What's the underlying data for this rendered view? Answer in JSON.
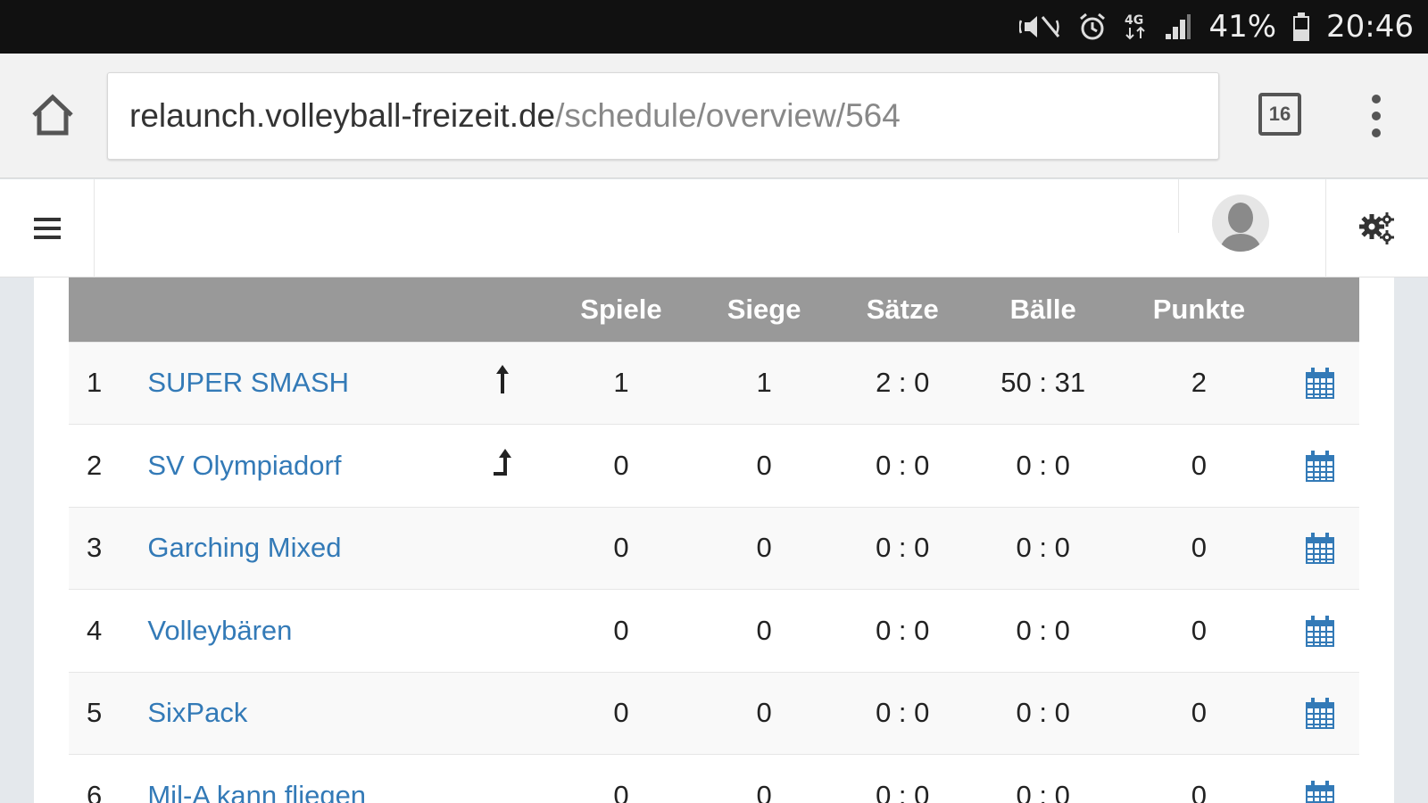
{
  "status_bar": {
    "battery_percent": "41%",
    "time": "20:46",
    "network": "4G"
  },
  "browser": {
    "url_host": "relaunch.volleyball-freizeit.de",
    "url_path": "/schedule/overview/564",
    "tab_count": "16"
  },
  "table": {
    "headers": {
      "spiele": "Spiele",
      "siege": "Siege",
      "saetze": "Sätze",
      "baelle": "Bälle",
      "punkte": "Punkte"
    },
    "rows": [
      {
        "rank": "1",
        "team": "SUPER SMASH",
        "trend": "up",
        "spiele": "1",
        "siege": "1",
        "saetze": "2 : 0",
        "baelle": "50 : 31",
        "punkte": "2"
      },
      {
        "rank": "2",
        "team": "SV Olympiadorf",
        "trend": "up-right",
        "spiele": "0",
        "siege": "0",
        "saetze": "0 : 0",
        "baelle": "0 : 0",
        "punkte": "0"
      },
      {
        "rank": "3",
        "team": "Garching Mixed",
        "trend": "",
        "spiele": "0",
        "siege": "0",
        "saetze": "0 : 0",
        "baelle": "0 : 0",
        "punkte": "0"
      },
      {
        "rank": "4",
        "team": "Volleybären",
        "trend": "",
        "spiele": "0",
        "siege": "0",
        "saetze": "0 : 0",
        "baelle": "0 : 0",
        "punkte": "0"
      },
      {
        "rank": "5",
        "team": "SixPack",
        "trend": "",
        "spiele": "0",
        "siege": "0",
        "saetze": "0 : 0",
        "baelle": "0 : 0",
        "punkte": "0"
      },
      {
        "rank": "6",
        "team": "Mil-A kann fliegen",
        "trend": "",
        "spiele": "0",
        "siege": "0",
        "saetze": "0 : 0",
        "baelle": "0 : 0",
        "punkte": "0"
      }
    ]
  },
  "colors": {
    "link": "#337ab7",
    "header_bg": "#999999",
    "calendar_icon": "#337ab7"
  },
  "icons": {
    "home": "home-icon",
    "tabs": "tabs-icon",
    "menu": "more-vert-icon",
    "hamburger": "hamburger-icon",
    "avatar": "avatar-icon",
    "settings": "gears-icon",
    "calendar": "calendar-icon",
    "trend_up": "arrow-up-icon",
    "trend_up_right": "arrow-up-right-icon"
  }
}
